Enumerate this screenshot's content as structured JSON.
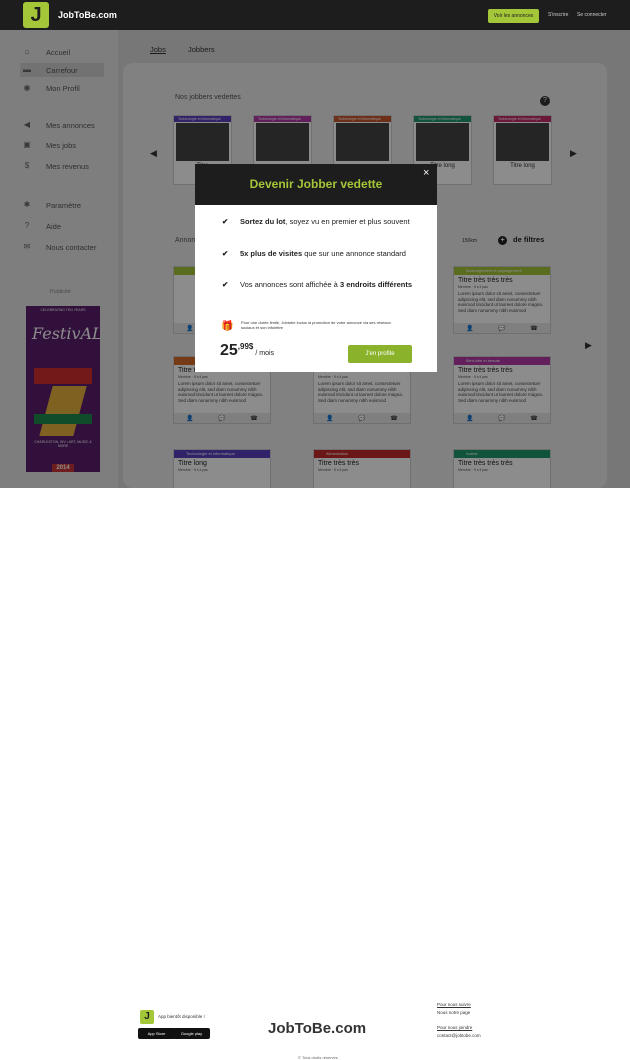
{
  "header": {
    "logo_letter": "J",
    "logo_text": "JobToBe.com",
    "ads_button": "Voir les annonces",
    "signup": "S'inscrire",
    "login": "Se connecter"
  },
  "sidebar": {
    "items": [
      {
        "label": "Accueil",
        "icon": "home-icon",
        "glyph": "⌂"
      },
      {
        "label": "Carrefour",
        "icon": "board-icon",
        "glyph": "▬"
      },
      {
        "label": "Mon Profil",
        "icon": "profile-icon",
        "glyph": "◉"
      },
      {
        "label": "Mes annonces",
        "icon": "megaphone-icon",
        "glyph": "◀"
      },
      {
        "label": "Mes jobs",
        "icon": "briefcase-icon",
        "glyph": "▣"
      },
      {
        "label": "Mes revenus",
        "icon": "money-icon",
        "glyph": "$"
      },
      {
        "label": "Paramètre",
        "icon": "gear-icon",
        "glyph": "✱"
      },
      {
        "label": "Aide",
        "icon": "help-icon",
        "glyph": "?"
      },
      {
        "label": "Nous contacter",
        "icon": "mail-icon",
        "glyph": "✉"
      }
    ],
    "pub_label": "Publicité",
    "ad": {
      "top": "CELEBRATING TEN YEARS",
      "title": "FestivALL",
      "bottom": "CHARLESTON, WV • ART, MUSIC & MORE",
      "year": "2014"
    }
  },
  "tabs": {
    "jobs": "Jobs",
    "jobbers": "Jobbers"
  },
  "featured": {
    "title": "Nos jobbers vedettes",
    "help": "?",
    "category": "Technologie et informatique",
    "cards": [
      {
        "title": "Titre",
        "color": "#5b3fbf"
      },
      {
        "title": "",
        "color": "#b23aa6"
      },
      {
        "title": "",
        "color": "#c8572c"
      },
      {
        "title": "Titre long",
        "color": "#1d9a6c"
      },
      {
        "title": "Titre long",
        "color": "#c42a6a"
      }
    ]
  },
  "listing": {
    "annonce_label": "Annonces",
    "distance": "150km",
    "filters": "de filtres"
  },
  "cards": [
    {
      "category": "",
      "color": "#a4c639",
      "title": "",
      "meta": "",
      "desc": ""
    },
    {
      "category": "",
      "color": "#5b3fbf",
      "title": "",
      "meta": "",
      "desc": ""
    },
    {
      "category": "Aménagement et paysagement",
      "color": "#a4c639",
      "title": "Titre très très très",
      "meta": "Membre · 5 s il pas",
      "desc": "Lorem ipsum dolor sit amet, consectetuer adipiscing elit, sed diam nonummy nibh euismod tincidunt ut laoreet dolore magna. Sed diam nonummy nibh euismod"
    },
    {
      "category": "",
      "color": "#d86a2a",
      "title": "Titre très très très très",
      "meta": "Membre · 5 s il pas",
      "desc": "Lorem ipsum dolor sit amet, consectetuer adipiscing elit, sed diam nonummy nibh euismod tincidunt ut laoreet dolore magna. Sed diam nonummy nibh euismod"
    },
    {
      "category": "",
      "color": "#c42a6a",
      "title": "Titre très très très très",
      "meta": "Membre · 5 s il pas",
      "desc": "Lorem ipsum dolor sit amet, consectetuer adipiscing elit, sed diam nonummy nibh euismod tincidunt ut laoreet dolore magna. Sed diam nonummy nibh euismod"
    },
    {
      "category": "Bien-être et beauté",
      "color": "#b23aa6",
      "title": "Titre très très très",
      "meta": "Membre · 5 s il pas",
      "desc": "Lorem ipsum dolor sit amet, consectetuer adipiscing elit, sed diam nonummy nibh euismod tincidunt ut laoreet dolore magna. Sed diam nonummy nibh euismod"
    },
    {
      "category": "Technologie et informatique",
      "color": "#5b3fbf",
      "title": "Titre long",
      "meta": "Membre · 5 s il pas",
      "desc": ""
    },
    {
      "category": "Alimentation",
      "color": "#c42a2a",
      "title": "Titre très très",
      "meta": "Membre · 5 s il pas",
      "desc": ""
    },
    {
      "category": "Autres",
      "color": "#1d9a6c",
      "title": "Titre très très très",
      "meta": "Membre · 5 s il pas",
      "desc": ""
    }
  ],
  "modal": {
    "title": "Devenir Jobber vedette",
    "close": "×",
    "features": [
      {
        "bold": "Sortez du lot",
        "rest": ", soyez vu en premier et plus souvent",
        "pre": ""
      },
      {
        "bold": "5x plus de visites",
        "rest": " que sur une annonce standard",
        "pre": ""
      },
      {
        "pre": "Vos annonces sont affichée à ",
        "bold": "3 endroits différents",
        "rest": ""
      }
    ],
    "promo": "Pour une durée limité, Jobtobe inclus la promotion de votre annonce via ses réseaux sociaux et son infolettre",
    "price_main": "25",
    "price_cents": ",99$",
    "price_per": "/ mois",
    "cta": "J'en profite"
  },
  "footer": {
    "app_text": "App bientôt disponible !",
    "app_store": "App Store",
    "google_play": "Google play",
    "brand": "JobToBe.com",
    "col1": {
      "title": "Pour nous suivre",
      "item": "Nous notre page"
    },
    "col2": {
      "title": "Pour nous joindre",
      "item": "contact@jobtobe.com"
    },
    "copyright": "© Tous droits réservés"
  }
}
